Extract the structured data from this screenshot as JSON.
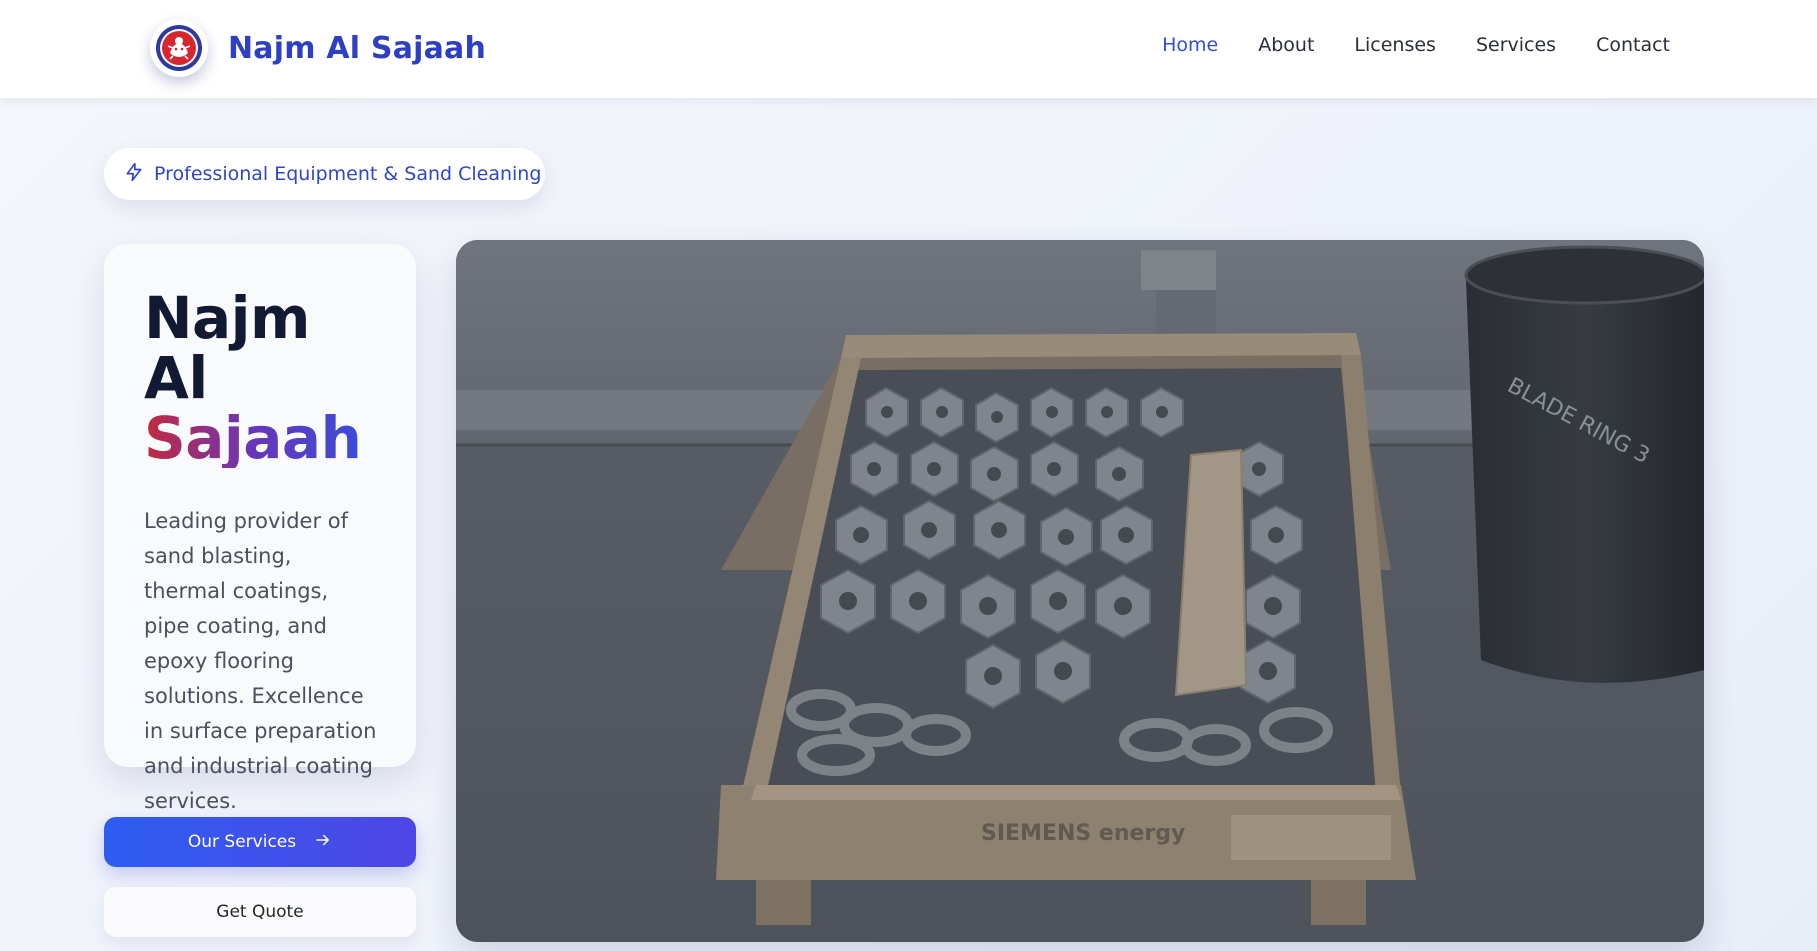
{
  "header": {
    "brand_name": "Najm Al Sajaah",
    "logo_icon": "company-logo-icon",
    "nav": [
      {
        "label": "Home",
        "active": true
      },
      {
        "label": "About",
        "active": false
      },
      {
        "label": "Licenses",
        "active": false
      },
      {
        "label": "Services",
        "active": false
      },
      {
        "label": "Contact",
        "active": false
      }
    ]
  },
  "badge": {
    "icon": "lightning-icon",
    "text": "Professional Equipment & Sand Cleaning"
  },
  "hero": {
    "title_line1": "Najm Al",
    "title_line2": "Sajaah",
    "description": "Leading provider of sand blasting, thermal coatings, pipe coating, and epoxy flooring solutions. Excellence in surface preparation and industrial coating services.",
    "primary_button": "Our Services",
    "primary_button_icon": "arrow-right-icon",
    "secondary_button": "Get Quote",
    "image_label": "SIEMENS energy",
    "drum_label": "BLADE RING 3"
  },
  "colors": {
    "brand": "#2d3fc4",
    "nav_active": "#2f4fd1",
    "primary_gradient_start": "#2d5df0",
    "primary_gradient_end": "#4f46e5",
    "title_gradient_start": "#c42a3c",
    "title_gradient_end": "#3350dd"
  }
}
